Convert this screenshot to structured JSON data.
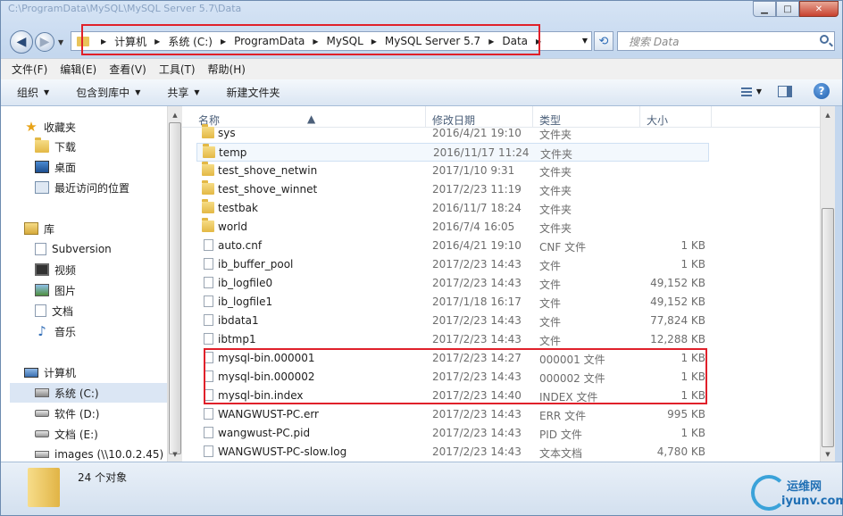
{
  "window": {
    "title": "C:\\ProgramData\\MySQL\\MySQL Server 5.7\\Data",
    "caption": {
      "minimize": "▁",
      "maximize": "□",
      "close": "✕"
    }
  },
  "address": {
    "crumbs": [
      "计算机",
      "系统 (C:)",
      "ProgramData",
      "MySQL",
      "MySQL Server 5.7",
      "Data"
    ]
  },
  "search": {
    "placeholder": "搜索 Data"
  },
  "menu": [
    "文件(F)",
    "编辑(E)",
    "查看(V)",
    "工具(T)",
    "帮助(H)"
  ],
  "commands": {
    "organize": "组织",
    "include_in_library": "包含到库中",
    "share": "共享",
    "new_folder": "新建文件夹"
  },
  "nav": {
    "favorites": "收藏夹",
    "downloads": "下载",
    "desktop": "桌面",
    "recent": "最近访问的位置",
    "libraries": "库",
    "subversion": "Subversion",
    "videos": "视频",
    "pictures": "图片",
    "documents": "文档",
    "music": "音乐",
    "computer": "计算机",
    "drive_c": "系统 (C:)",
    "drive_d": "软件 (D:)",
    "drive_e": "文档 (E:)",
    "net_drive": "images (\\\\10.0.2.45) (\\"
  },
  "columns": {
    "name": "名称",
    "date": "修改日期",
    "type": "类型",
    "size": "大小"
  },
  "files": [
    {
      "name": "sys",
      "date": "2016/4/21 19:10",
      "type": "文件夹",
      "size": "",
      "kind": "folder"
    },
    {
      "name": "temp",
      "date": "2016/11/17 11:24",
      "type": "文件夹",
      "size": "",
      "kind": "folder"
    },
    {
      "name": "test_shove_netwin",
      "date": "2017/1/10 9:31",
      "type": "文件夹",
      "size": "",
      "kind": "folder"
    },
    {
      "name": "test_shove_winnet",
      "date": "2017/2/23 11:19",
      "type": "文件夹",
      "size": "",
      "kind": "folder"
    },
    {
      "name": "testbak",
      "date": "2016/11/7 18:24",
      "type": "文件夹",
      "size": "",
      "kind": "folder"
    },
    {
      "name": "world",
      "date": "2016/7/4 16:05",
      "type": "文件夹",
      "size": "",
      "kind": "folder"
    },
    {
      "name": "auto.cnf",
      "date": "2016/4/21 19:10",
      "type": "CNF 文件",
      "size": "1 KB",
      "kind": "file"
    },
    {
      "name": "ib_buffer_pool",
      "date": "2017/2/23 14:43",
      "type": "文件",
      "size": "1 KB",
      "kind": "file"
    },
    {
      "name": "ib_logfile0",
      "date": "2017/2/23 14:43",
      "type": "文件",
      "size": "49,152 KB",
      "kind": "file"
    },
    {
      "name": "ib_logfile1",
      "date": "2017/1/18 16:17",
      "type": "文件",
      "size": "49,152 KB",
      "kind": "file"
    },
    {
      "name": "ibdata1",
      "date": "2017/2/23 14:43",
      "type": "文件",
      "size": "77,824 KB",
      "kind": "file"
    },
    {
      "name": "ibtmp1",
      "date": "2017/2/23 14:43",
      "type": "文件",
      "size": "12,288 KB",
      "kind": "file"
    },
    {
      "name": "mysql-bin.000001",
      "date": "2017/2/23 14:27",
      "type": "000001 文件",
      "size": "1 KB",
      "kind": "file"
    },
    {
      "name": "mysql-bin.000002",
      "date": "2017/2/23 14:43",
      "type": "000002 文件",
      "size": "1 KB",
      "kind": "file"
    },
    {
      "name": "mysql-bin.index",
      "date": "2017/2/23 14:40",
      "type": "INDEX 文件",
      "size": "1 KB",
      "kind": "file"
    },
    {
      "name": "WANGWUST-PC.err",
      "date": "2017/2/23 14:43",
      "type": "ERR 文件",
      "size": "995 KB",
      "kind": "file"
    },
    {
      "name": "wangwust-PC.pid",
      "date": "2017/2/23 14:43",
      "type": "PID 文件",
      "size": "1 KB",
      "kind": "file"
    },
    {
      "name": "WANGWUST-PC-slow.log",
      "date": "2017/2/23 14:43",
      "type": "文本文档",
      "size": "4,780 KB",
      "kind": "file"
    }
  ],
  "status": {
    "count": "24 个对象"
  },
  "watermark": {
    "top": "运维网",
    "bottom": "iyunv.com"
  },
  "colors": {
    "highlight": "#e0202a",
    "folder": "#e3b845",
    "accent": "#1f6fb4"
  }
}
